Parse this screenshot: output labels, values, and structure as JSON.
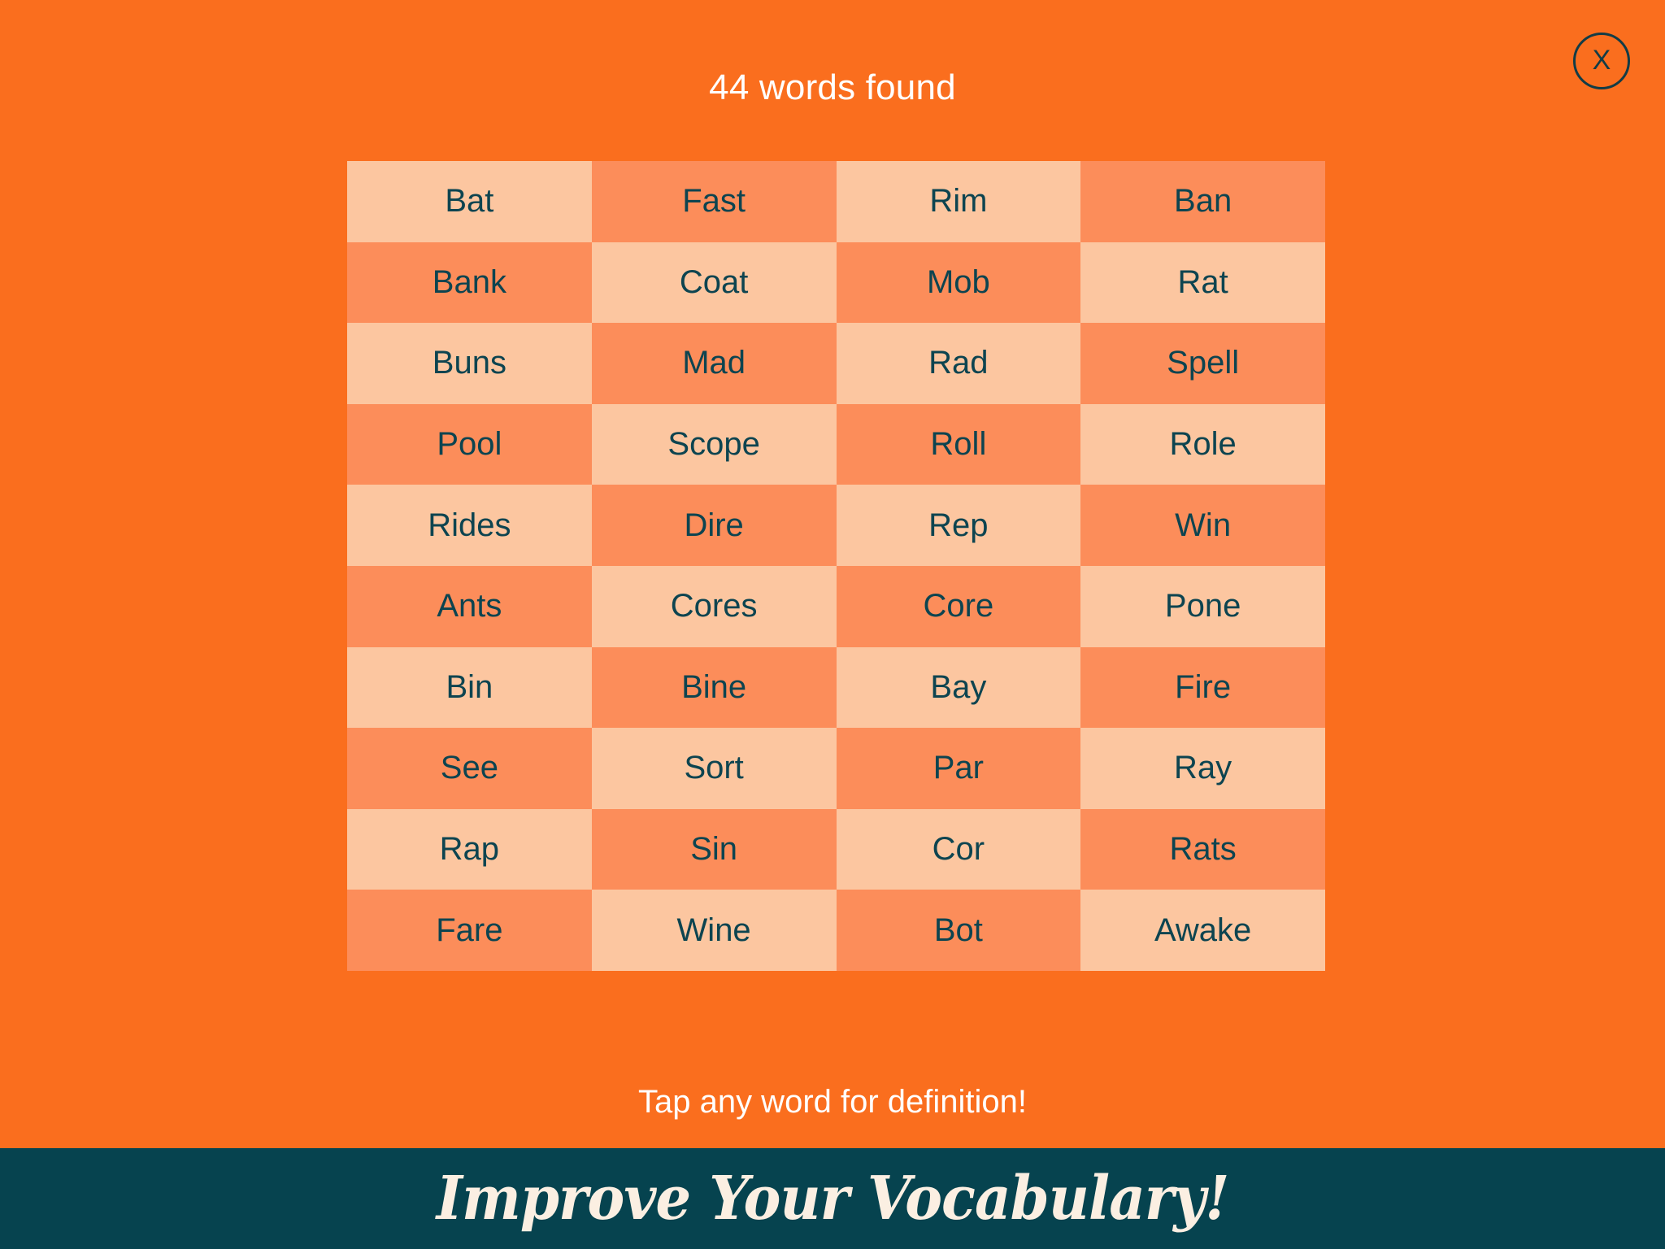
{
  "screen": {
    "background_color": "#FA6E1E",
    "title": "44 words found",
    "tap_hint": "Tap any word for definition!"
  },
  "close_button": {
    "name": "close",
    "glyph": "X",
    "icon": "close-x-circle-icon",
    "color": "#123C46"
  },
  "grid": {
    "columns": 4,
    "rows": 10,
    "cell_light_color": "#FCC6A0",
    "cell_dark_color": "#FC8D5A",
    "text_color": "#0D4450",
    "words": [
      "Bat",
      "Fast",
      "Rim",
      "Ban",
      "Bank",
      "Coat",
      "Mob",
      "Rat",
      "Buns",
      "Mad",
      "Rad",
      "Spell",
      "Pool",
      "Scope",
      "Roll",
      "Role",
      "Rides",
      "Dire",
      "Rep",
      "Win",
      "Ants",
      "Cores",
      "Core",
      "Pone",
      "Bin",
      "Bine",
      "Bay",
      "Fire",
      "See",
      "Sort",
      "Par",
      "Ray",
      "Rap",
      "Sin",
      "Cor",
      "Rats",
      "Fare",
      "Wine",
      "Bot",
      "Awake"
    ]
  },
  "banner": {
    "text": "Improve Your Vocabulary!",
    "background_color": "#06434F",
    "text_color": "#FBEFE2"
  }
}
